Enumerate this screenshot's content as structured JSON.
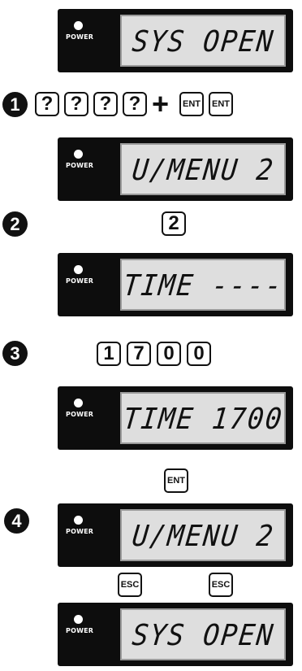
{
  "power_label": "POWER",
  "panels": [
    {
      "text": "SYS OPEN"
    },
    {
      "text": "U/MENU 2"
    },
    {
      "text": "TIME ----"
    },
    {
      "text": "TIME 1700"
    },
    {
      "text": "U/MENU 2"
    },
    {
      "text": "SYS OPEN"
    }
  ],
  "steps": [
    "1",
    "2",
    "3",
    "4"
  ],
  "step1": {
    "keys": [
      "?",
      "?",
      "?",
      "?"
    ],
    "plus": "+",
    "enter_keys": [
      "ENT",
      "ENT"
    ]
  },
  "step2": {
    "key": "2"
  },
  "step3": {
    "keys": [
      "1",
      "7",
      "0",
      "0"
    ]
  },
  "enter_key": "ENT",
  "escape_keys": [
    "ESC",
    "ESC"
  ]
}
